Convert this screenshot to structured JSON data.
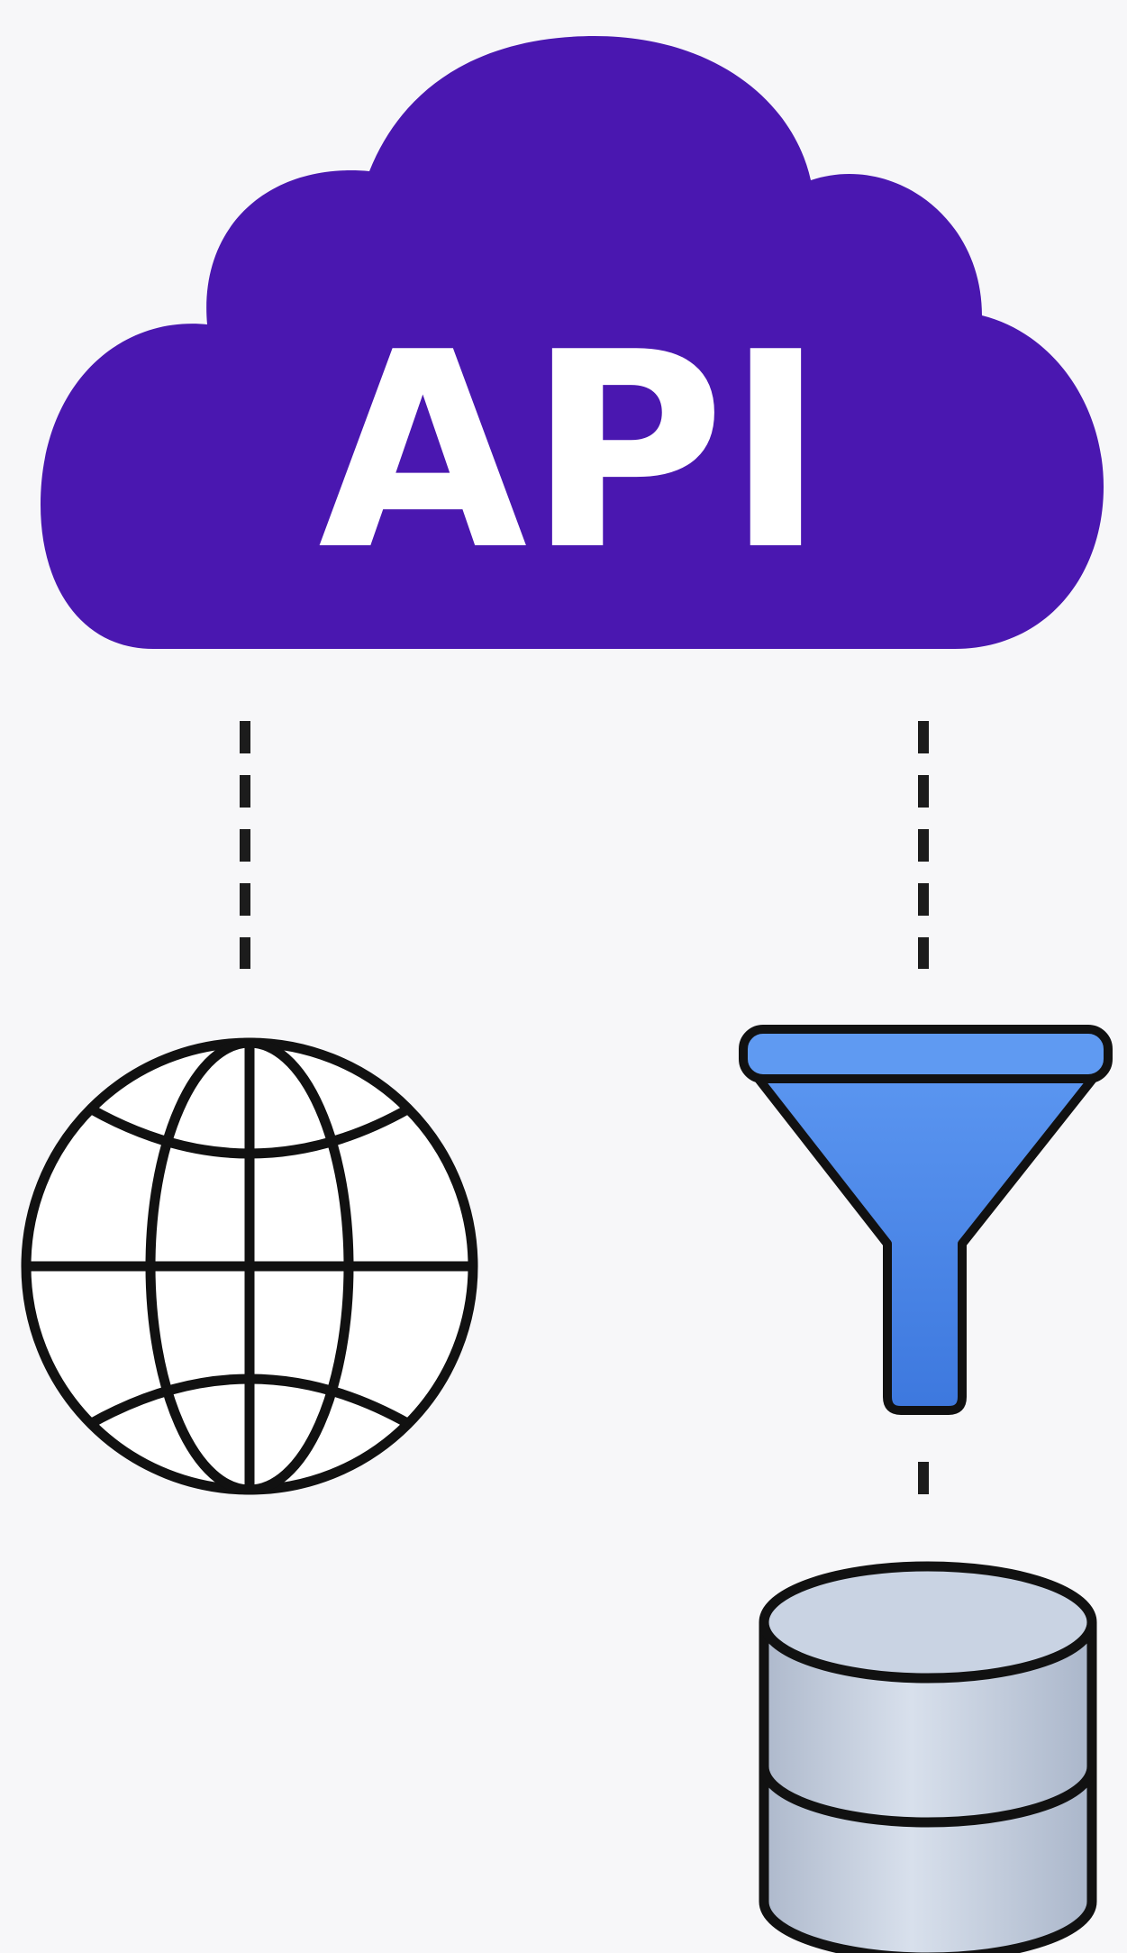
{
  "cloud": {
    "label": "API",
    "color": "#4a17b0",
    "icon": "cloud-icon"
  },
  "nodes": [
    {
      "name": "globe",
      "icon": "globe-icon",
      "stroke": "#111111",
      "fill": "#ffffff"
    },
    {
      "name": "filter",
      "icon": "funnel-icon",
      "fill": "#4a86e8",
      "stroke": "#111111"
    },
    {
      "name": "database",
      "icon": "database-icon",
      "fill": "#c4cfe0",
      "stroke": "#111111"
    }
  ],
  "connectors": [
    {
      "from": "cloud",
      "to": "globe",
      "style": "dashed"
    },
    {
      "from": "cloud",
      "to": "filter",
      "style": "dashed"
    },
    {
      "from": "filter",
      "to": "database",
      "style": "dashed"
    }
  ],
  "background": "#f7f7f9"
}
